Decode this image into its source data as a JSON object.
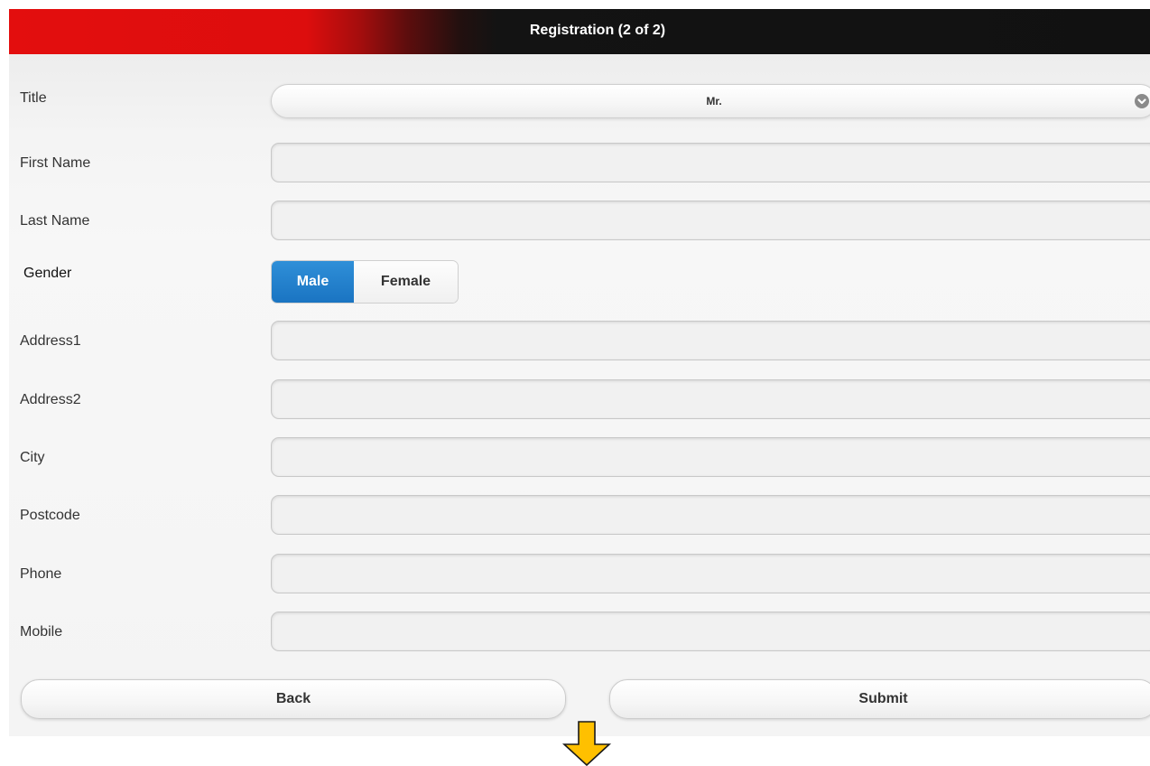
{
  "header": {
    "title": "Registration (2 of 2)"
  },
  "form": {
    "title": {
      "label": "Title",
      "value": "Mr."
    },
    "first_name": {
      "label": "First Name",
      "value": ""
    },
    "last_name": {
      "label": "Last Name",
      "value": ""
    },
    "gender": {
      "label": "Gender",
      "options": [
        "Male",
        "Female"
      ],
      "selected": "Male"
    },
    "address1": {
      "label": "Address1",
      "value": ""
    },
    "address2": {
      "label": "Address2",
      "value": ""
    },
    "city": {
      "label": "City",
      "value": ""
    },
    "postcode": {
      "label": "Postcode",
      "value": ""
    },
    "phone": {
      "label": "Phone",
      "value": ""
    },
    "mobile": {
      "label": "Mobile",
      "value": ""
    }
  },
  "actions": {
    "back_label": "Back",
    "submit_label": "Submit"
  },
  "colors": {
    "header_red": "#e30e0e",
    "header_dark": "#111111",
    "segment_active": "#1a74c2",
    "arrow_fill": "#ffc000"
  },
  "icons": {
    "select_chevron": "chevron-down-icon",
    "annotation_arrow": "down-arrow-icon"
  }
}
